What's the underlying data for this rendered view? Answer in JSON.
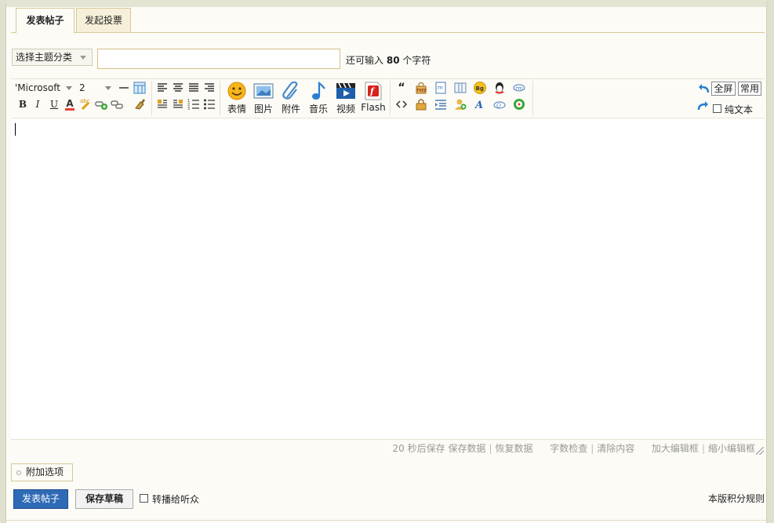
{
  "tabs": [
    {
      "label": "发表帖子",
      "active": true
    },
    {
      "label": "发起投票",
      "active": false
    }
  ],
  "subject": {
    "category_select": "选择主题分类",
    "title_value": "",
    "charcount_prefix": "还可输入",
    "charcount_value": "80",
    "charcount_suffix": "个字符"
  },
  "toolbar": {
    "font_family": "'Microsoft",
    "font_size": "2",
    "media": [
      {
        "label": "表情",
        "icon": "smiley-icon"
      },
      {
        "label": "图片",
        "icon": "image-icon"
      },
      {
        "label": "附件",
        "icon": "paperclip-icon"
      },
      {
        "label": "音乐",
        "icon": "music-note-icon"
      },
      {
        "label": "视频",
        "icon": "video-clapper-icon"
      },
      {
        "label": "Flash",
        "icon": "flash-icon"
      }
    ],
    "fullscreen": "全屏",
    "common": "常用",
    "plaintext": "纯文本"
  },
  "statusbar": {
    "autosave": "20 秒后保存",
    "save_data": "保存数据",
    "restore_data": "恢复数据",
    "word_check": "字数检查",
    "clear_content": "清除内容",
    "enlarge": "加大编辑框",
    "shrink": "缩小编辑框"
  },
  "extra_options": "附加选项",
  "actions": {
    "submit": "发表帖子",
    "save_draft": "保存草稿",
    "broadcast": "转播给听众",
    "credit_rules": "本版积分规则"
  },
  "colors": {
    "accent": "#2e6ab5",
    "border": "#d8c99a",
    "panel": "#fcfbf6"
  }
}
